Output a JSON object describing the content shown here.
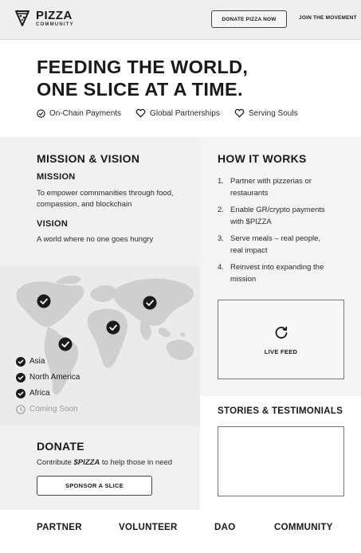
{
  "header": {
    "brand_name": "PIZZA",
    "brand_sub": "COMMUNITY",
    "donate_label": "DONATE PIZZA NOW",
    "join_label": "JOIN THE MOVEMENT"
  },
  "hero": {
    "title_line1": "FEEDING THE WORLD,",
    "title_line2": "ONE SLICE AT A TIME.",
    "features": [
      {
        "label": "On-Chain Payments",
        "icon": "check-circle-icon"
      },
      {
        "label": "Global Partnerships",
        "icon": "heart-icon"
      },
      {
        "label": "Serving Souls",
        "icon": "heart-icon"
      }
    ]
  },
  "mission": {
    "heading": "MISSION & VISION",
    "mission_heading": "MISSION",
    "mission_text": "To empower comnmanities through food, compassion, and blockchain",
    "vision_heading": "VISION",
    "vision_text": "A world where no one goes hungry"
  },
  "how": {
    "heading": "HOW IT WORKS",
    "steps": [
      {
        "num": "1.",
        "text": "Partner with pizzerias or restaurants"
      },
      {
        "num": "2.",
        "text": "Enable GR/crypto payments with $PIZZA"
      },
      {
        "num": "3.",
        "text": "Serve meals – real people, real impact"
      },
      {
        "num": "4.",
        "text": "Reinvest into expanding the mission"
      }
    ]
  },
  "live_feed": {
    "label": "LIVE FEED",
    "icon": "refresh-icon"
  },
  "regions": [
    {
      "label": "Asia",
      "status": "active"
    },
    {
      "label": "North America",
      "status": "active"
    },
    {
      "label": "Africa",
      "status": "active"
    },
    {
      "label": "Coming Soon",
      "status": "pending"
    }
  ],
  "stories": {
    "heading": "STORIES & TESTIMONIALS"
  },
  "donate": {
    "heading": "DONATE",
    "text_prefix": "Contribute ",
    "text_token": "$PIZZA",
    "text_suffix": " to help those in need",
    "button_label": "SPONSOR A SLICE"
  },
  "footer_nav": [
    "PARTNER",
    "VOLUNTEER",
    "DAO",
    "COMMUNITY"
  ],
  "colors": {
    "dark": "#1a1a1a",
    "panel": "#f1f1f1",
    "header": "#eeeeee",
    "map_land": "#cfcfcf"
  }
}
